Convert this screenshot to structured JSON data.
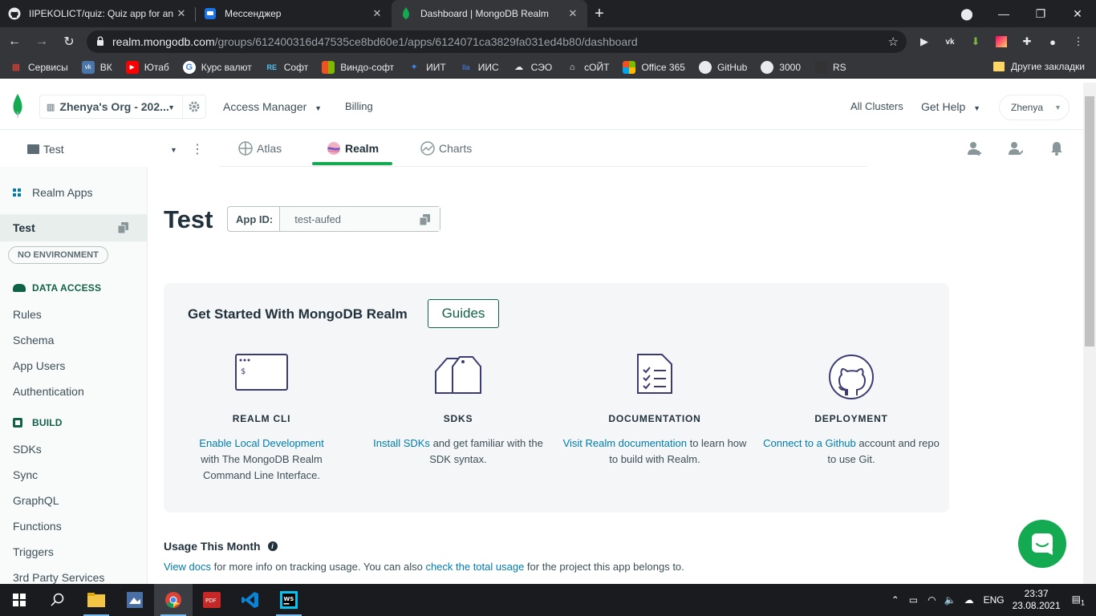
{
  "browser": {
    "tabs": [
      {
        "title": "IIPEKOLICT/quiz: Quiz app for an",
        "icon": "github-icon"
      },
      {
        "title": "Мессенджер",
        "icon": "messenger-icon"
      },
      {
        "title": "Dashboard | MongoDB Realm",
        "icon": "mongodb-leaf-icon",
        "active": true
      }
    ],
    "url_host": "realm.mongodb.com",
    "url_path": "/groups/612400316d47535ce8bd60e1/apps/6124071ca3829fa031ed4b80/dashboard",
    "bookmarks": [
      "Сервисы",
      "ВК",
      "Ютаб",
      "Курс валют",
      "Софт",
      "Виндо-софт",
      "ИИТ",
      "ИИС",
      "СЭО",
      "сОЙТ",
      "Office 365",
      "GitHub",
      "3000",
      "RS"
    ],
    "bookmarks_other": "Другие закладки"
  },
  "topnav": {
    "org": "Zhenya's Org - 202...",
    "access_manager": "Access Manager",
    "billing": "Billing",
    "all_clusters": "All Clusters",
    "get_help": "Get Help",
    "user": "Zhenya"
  },
  "projectnav": {
    "project": "Test",
    "tabs": [
      "Atlas",
      "Realm",
      "Charts"
    ],
    "active_tab": "Realm"
  },
  "sidebar": {
    "realm_apps": "Realm Apps",
    "app": "Test",
    "environment": "NO ENVIRONMENT",
    "data_access": "DATA ACCESS",
    "data_access_items": [
      "Rules",
      "Schema",
      "App Users",
      "Authentication"
    ],
    "build": "BUILD",
    "build_items": [
      "SDKs",
      "Sync",
      "GraphQL",
      "Functions",
      "Triggers",
      "3rd Party Services"
    ]
  },
  "main": {
    "title": "Test",
    "app_id_label": "App ID:",
    "app_id": "test-aufed",
    "card_title": "Get Started With MongoDB Realm",
    "guides": "Guides",
    "columns": [
      {
        "icon": "terminal-icon",
        "heading": "REALM CLI",
        "link": "Enable Local Development",
        "text": "with The MongoDB Realm Command Line Interface."
      },
      {
        "icon": "sdk-tags-icon",
        "heading": "SDKS",
        "link": "Install SDKs",
        "text": "and get familiar with the SDK syntax."
      },
      {
        "icon": "checklist-document-icon",
        "heading": "DOCUMENTATION",
        "link": "Visit Realm documentation",
        "text": "to learn how to build with Realm."
      },
      {
        "icon": "github-icon",
        "heading": "DEPLOYMENT",
        "link": "Connect to a Github",
        "text": "account and repo to use Git."
      }
    ],
    "usage_title": "Usage This Month",
    "usage_link1": "View docs",
    "usage_text1": "for more info on tracking usage. You can also",
    "usage_link2": "check the total usage",
    "usage_text2": "for the project this app belongs to."
  },
  "taskbar": {
    "language": "ENG",
    "time": "23:37",
    "date": "23.08.2021",
    "notifications": "1"
  },
  "colors": {
    "accent_green": "#13aa52",
    "link_blue": "#007cad",
    "dark_green": "#116149"
  }
}
